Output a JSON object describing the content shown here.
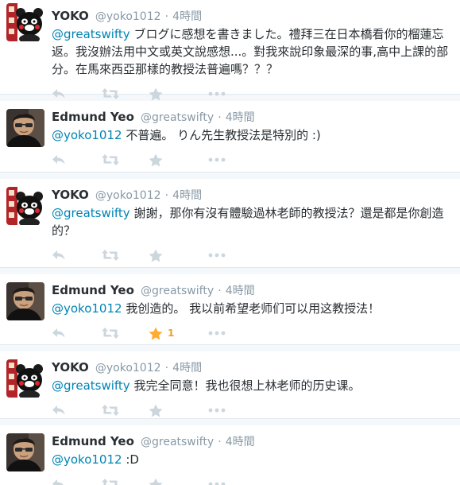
{
  "tweets": [
    {
      "author": "yoko",
      "fullname": "YOKO",
      "username": "@yoko1012",
      "separator": "·",
      "time": "4時間",
      "mention": "@greatswifty",
      "text": " ブログに感想を書きました。禮拜三在日本橋看你的榴蓮忘返。我沒辦法用中文或英文說感想...。對我來說印象最深的事,高中上課的部分。在馬來西亞那樣的教授法普遍嗎？？？",
      "fav_count": "",
      "favorited": false
    },
    {
      "author": "edmund",
      "fullname": "Edmund Yeo",
      "username": "@greatswifty",
      "separator": "·",
      "time": "4時間",
      "mention": "@yoko1012",
      "text": " 不普遍。 りん先生教授法是特別的 :)",
      "fav_count": "",
      "favorited": false
    },
    {
      "author": "yoko",
      "fullname": "YOKO",
      "username": "@yoko1012",
      "separator": "·",
      "time": "4時間",
      "mention": "@greatswifty",
      "text": " 謝謝，那你有沒有體驗過林老師的教授法？還是都是你創造的？",
      "fav_count": "",
      "favorited": false
    },
    {
      "author": "edmund",
      "fullname": "Edmund Yeo",
      "username": "@greatswifty",
      "separator": "·",
      "time": "4時間",
      "mention": "@yoko1012",
      "text": " 我创造的。 我以前希望老师们可以用这教授法！",
      "fav_count": "1",
      "favorited": true
    },
    {
      "author": "yoko",
      "fullname": "YOKO",
      "username": "@yoko1012",
      "separator": "·",
      "time": "4時間",
      "mention": "@greatswifty",
      "text": " 我完全同意！我也很想上林老师的历史课。",
      "fav_count": "",
      "favorited": false
    },
    {
      "author": "edmund",
      "fullname": "Edmund Yeo",
      "username": "@greatswifty",
      "separator": "·",
      "time": "4時間",
      "mention": "@yoko1012",
      "text": " :D",
      "fav_count": "",
      "favorited": false
    }
  ],
  "icons": {
    "reply": "reply-icon",
    "retweet": "retweet-icon",
    "favorite": "star-icon",
    "more": "more-icon"
  },
  "colors": {
    "name": "#292f33",
    "meta": "#8899a6",
    "mention": "#0084b4",
    "action_icon": "#ccd6dd",
    "favorited": "#ffac33",
    "background": "#f5f8fa"
  }
}
